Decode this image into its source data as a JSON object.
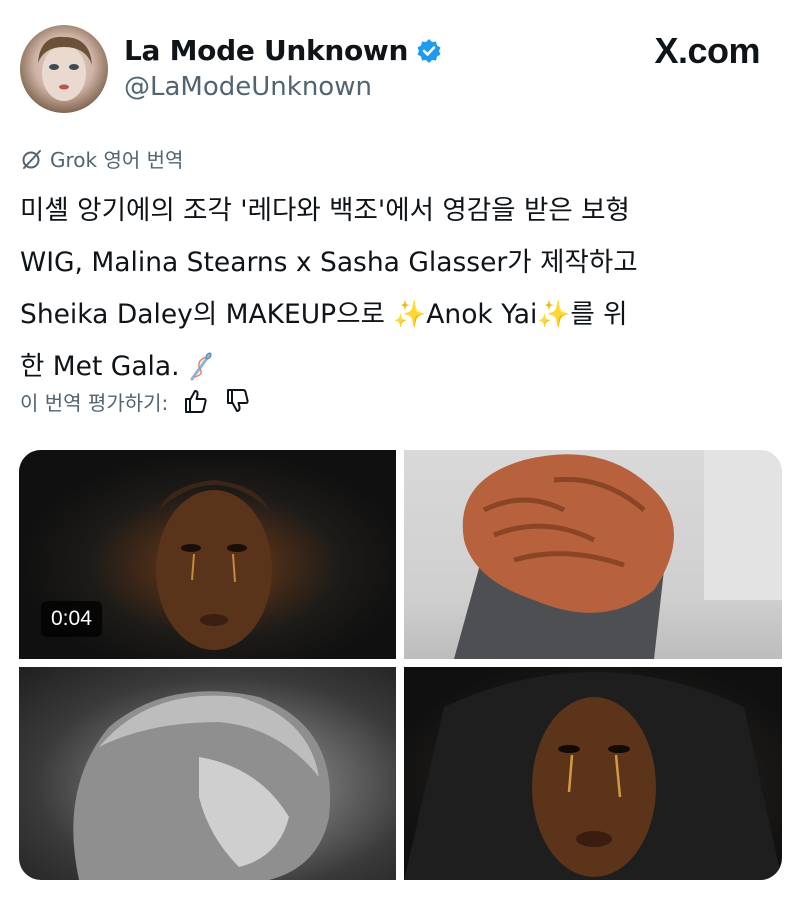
{
  "header": {
    "display_name": "La Mode Unknown",
    "handle": "@LaModeUnknown",
    "site": "X.com",
    "verified_color": "#1d9bf0"
  },
  "translation": {
    "label": "Grok 영어 번역",
    "icon": "grok-icon",
    "rate_label": "이 번역 평가하기:",
    "icons": [
      "thumbs-up-icon",
      "thumbs-down-icon"
    ]
  },
  "tweet": {
    "line1": "미셸 앙기에의 조각 '레다와 백조'에서 영감을 받은 보형",
    "line2": "WIG, Malina Stearns x Sasha Glasser가 제작하고",
    "line3_a": "Sheika Daley의 MAKEUP으로 ",
    "sparkle_1": "✨",
    "line3_b": "Anok Yai",
    "sparkle_2": "✨",
    "line3_c": "를 위",
    "line4": "한 Met Gala.",
    "needle_emoji": "🪡"
  },
  "media": {
    "video_duration": "0:04"
  }
}
